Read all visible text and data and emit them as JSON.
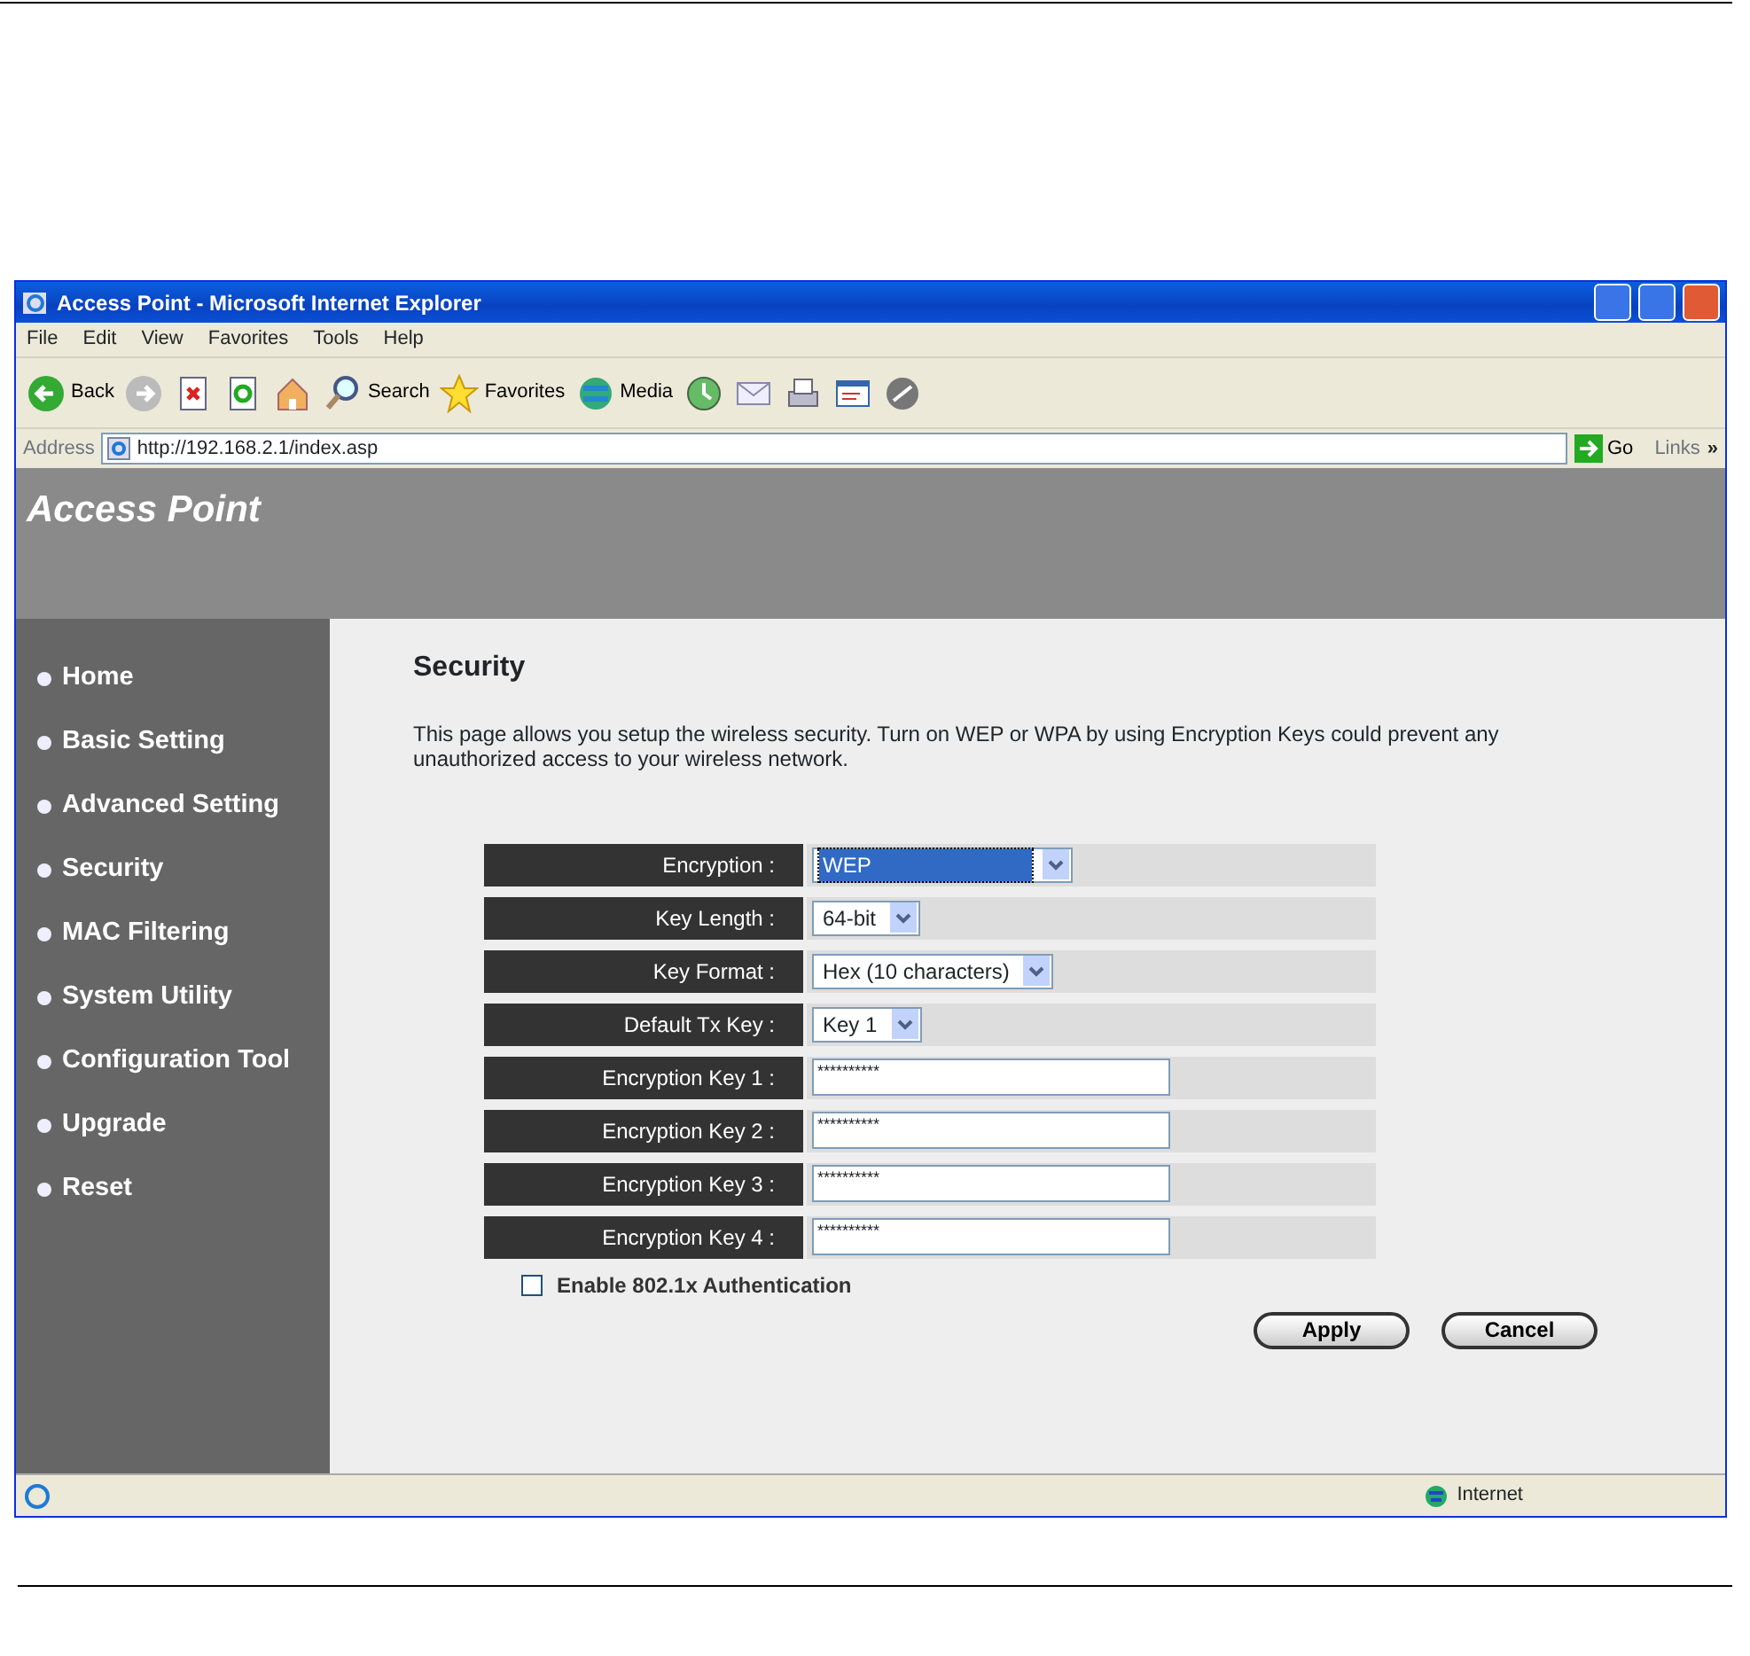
{
  "window": {
    "title": "Access Point - Microsoft Internet Explorer"
  },
  "menu": [
    "File",
    "Edit",
    "View",
    "Favorites",
    "Tools",
    "Help"
  ],
  "toolbar": [
    {
      "kind": "back",
      "label": "Back"
    },
    {
      "kind": "forward"
    },
    {
      "kind": "stop"
    },
    {
      "kind": "refresh"
    },
    {
      "kind": "home"
    },
    {
      "kind": "search",
      "label": "Search"
    },
    {
      "kind": "favorites",
      "label": "Favorites"
    },
    {
      "kind": "media",
      "label": "Media"
    },
    {
      "kind": "history"
    },
    {
      "kind": "mail"
    },
    {
      "kind": "print"
    },
    {
      "kind": "edit"
    },
    {
      "kind": "messenger"
    }
  ],
  "address_bar": {
    "label": "Address",
    "url": "http://192.168.2.1/index.asp",
    "go": "Go",
    "links": "Links",
    "more": "»"
  },
  "banner": {
    "title": "Access Point"
  },
  "sidebar": {
    "items": [
      "Home",
      "Basic Setting",
      "Advanced Setting",
      "Security",
      "MAC Filtering",
      "System Utility",
      "Configuration Tool",
      "Upgrade",
      "Reset"
    ]
  },
  "content": {
    "heading": "Security",
    "description": "This page allows you setup the wireless security. Turn on WEP or WPA by using Encryption Keys could prevent any unauthorized access to your wireless network.",
    "rows": [
      {
        "kind": "select",
        "label": "Encryption :",
        "value": "WEP",
        "focused": true
      },
      {
        "kind": "select",
        "label": "Key Length :",
        "value": "64-bit",
        "focused": false
      },
      {
        "kind": "select",
        "label": "Key Format :",
        "value": "Hex (10 characters)",
        "focused": false
      },
      {
        "kind": "select",
        "label": "Default Tx Key :",
        "value": "Key 1",
        "focused": false
      },
      {
        "kind": "password",
        "label": "Encryption Key 1 :",
        "value": "**********"
      },
      {
        "kind": "password",
        "label": "Encryption Key 2 :",
        "value": "**********"
      },
      {
        "kind": "password",
        "label": "Encryption Key 3 :",
        "value": "**********"
      },
      {
        "kind": "password",
        "label": "Encryption Key 4 :",
        "value": "**********"
      }
    ],
    "checkbox": {
      "label": "Enable 802.1x Authentication",
      "checked": false
    },
    "buttons": [
      "Apply",
      "Cancel"
    ]
  },
  "status_bar": {
    "zone": "Internet"
  }
}
